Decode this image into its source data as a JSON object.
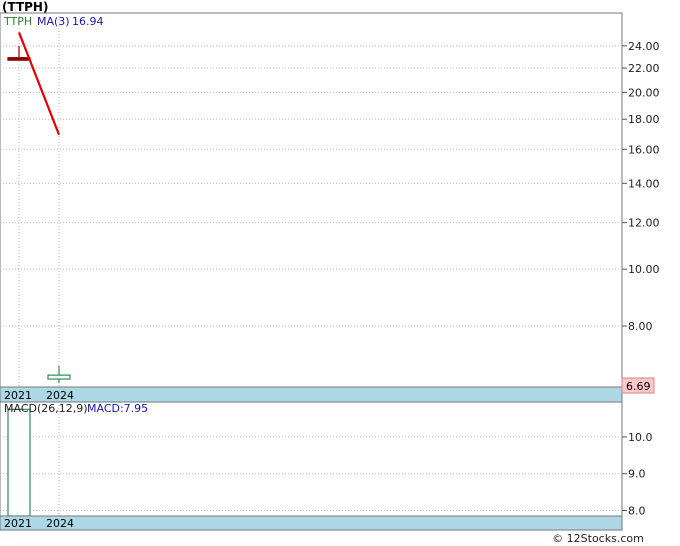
{
  "chart_data": [
    {
      "type": "candlestick",
      "title": "(TTPH)",
      "ticker": "TTPH",
      "indicator_label": "MA(3)",
      "indicator_value": "16.94",
      "x_labels": [
        "2021",
        "2024"
      ],
      "y_ticks": [
        "24.00",
        "22.00",
        "20.00",
        "18.00",
        "16.00",
        "14.00",
        "12.00",
        "10.00",
        "8.00"
      ],
      "y_tick_values": [
        24,
        22,
        20,
        18,
        16,
        14,
        12,
        10,
        8
      ],
      "ylim": [
        6.3,
        27.3
      ],
      "log_scale": true,
      "grid": true,
      "last_price": "6.69",
      "candles": [
        {
          "x": "2021",
          "open": 22.8,
          "high": 24.0,
          "low": 22.8,
          "close": 22.8,
          "color": "#8b0000"
        },
        {
          "x": "2024",
          "open": 6.5,
          "high": 6.85,
          "low": 6.4,
          "close": 6.6,
          "color": "#2e8b57"
        }
      ],
      "ma_line": {
        "name": "MA(3)",
        "color": "#e00000",
        "points": [
          {
            "x": "2021",
            "y": 25.3
          },
          {
            "x": "2024",
            "y": 16.94
          }
        ]
      }
    },
    {
      "type": "bar",
      "title": "MACD(26,12,9)",
      "indicator_label": "MACD:7.95",
      "x_labels": [
        "2021",
        "2024"
      ],
      "y_ticks": [
        "10.0",
        "9.0",
        "8.0"
      ],
      "y_tick_values": [
        10,
        9,
        8
      ],
      "ylim": [
        7.85,
        10.95
      ],
      "grid": true,
      "bars": [
        {
          "x": "2021",
          "value": 10.75,
          "color": "#2e8b57"
        }
      ]
    }
  ],
  "footer": {
    "copyright": "© 12Stocks.com"
  },
  "colors": {
    "axis_band": "#add8e6",
    "price_box": "#ffc8c8",
    "grid": "#bbbbbb"
  }
}
